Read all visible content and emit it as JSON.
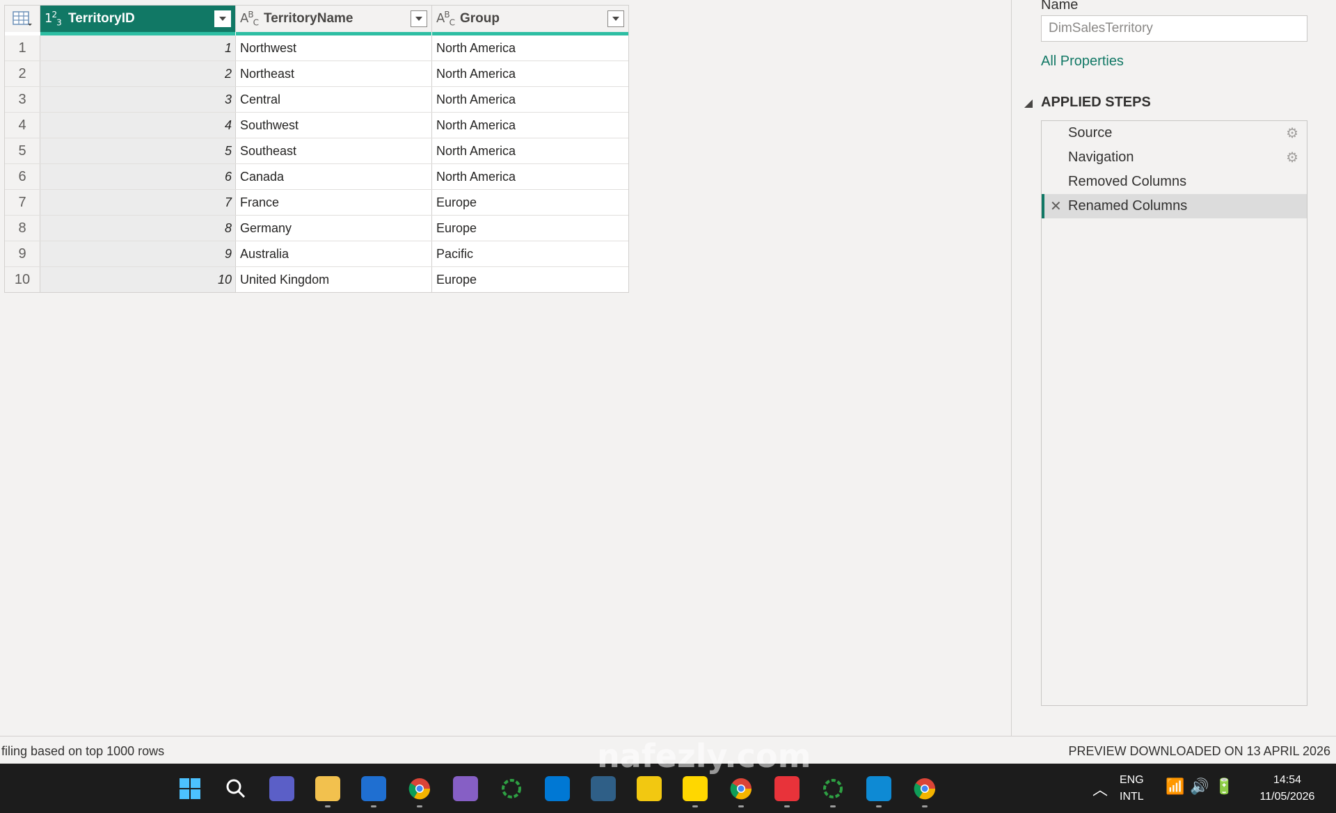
{
  "grid": {
    "columns": [
      {
        "type_icon": "123",
        "label": "TerritoryID"
      },
      {
        "type_icon": "ABC",
        "label": "TerritoryName"
      },
      {
        "type_icon": "ABC",
        "label": "Group"
      }
    ],
    "rows": [
      {
        "n": "1",
        "id": "1",
        "name": "Northwest",
        "group": "North America"
      },
      {
        "n": "2",
        "id": "2",
        "name": "Northeast",
        "group": "North America"
      },
      {
        "n": "3",
        "id": "3",
        "name": "Central",
        "group": "North America"
      },
      {
        "n": "4",
        "id": "4",
        "name": "Southwest",
        "group": "North America"
      },
      {
        "n": "5",
        "id": "5",
        "name": "Southeast",
        "group": "North America"
      },
      {
        "n": "6",
        "id": "6",
        "name": "Canada",
        "group": "North America"
      },
      {
        "n": "7",
        "id": "7",
        "name": "France",
        "group": "Europe"
      },
      {
        "n": "8",
        "id": "8",
        "name": "Germany",
        "group": "Europe"
      },
      {
        "n": "9",
        "id": "9",
        "name": "Australia",
        "group": "Pacific"
      },
      {
        "n": "10",
        "id": "10",
        "name": "United Kingdom",
        "group": "Europe"
      }
    ]
  },
  "properties": {
    "name_label": "Name",
    "name_value": "DimSalesTerritory",
    "all_properties_link": "All Properties"
  },
  "applied_steps": {
    "title": "APPLIED STEPS",
    "steps": [
      {
        "label": "Source",
        "has_gear": true
      },
      {
        "label": "Navigation",
        "has_gear": true
      },
      {
        "label": "Removed Columns",
        "has_gear": false
      },
      {
        "label": "Renamed Columns",
        "has_gear": false,
        "selected": true
      }
    ]
  },
  "status_bar": {
    "left": "filing based on top 1000 rows",
    "right": "PREVIEW DOWNLOADED ON 13 APRIL 2026"
  },
  "taskbar": {
    "apps": [
      {
        "icon": "windows-start-icon",
        "color": "#2b88d8"
      },
      {
        "icon": "search-icon",
        "color": "#1c1c1c"
      },
      {
        "icon": "teams-icon",
        "color": "#5b5fc7"
      },
      {
        "icon": "file-explorer-icon",
        "color": "#f2c14e"
      },
      {
        "icon": "app-store-icon",
        "color": "#1f6fd1"
      },
      {
        "icon": "chrome-icon",
        "color": "#db4437"
      },
      {
        "icon": "visual-studio-icon",
        "color": "#865fc5"
      },
      {
        "icon": "loading-ring-icon",
        "color": "#2ea043"
      },
      {
        "icon": "vscode-icon",
        "color": "#0078d4"
      },
      {
        "icon": "mysql-workbench-icon",
        "color": "#2f5f87"
      },
      {
        "icon": "power-bi-icon",
        "color": "#f2c811"
      },
      {
        "icon": "sticky-notes-icon",
        "color": "#ffd700"
      },
      {
        "icon": "chrome-profile-icon",
        "color": "#db4437"
      },
      {
        "icon": "mail-icon",
        "color": "#e8333a"
      },
      {
        "icon": "loading-ring-icon-2",
        "color": "#2ea043"
      },
      {
        "icon": "photos-icon",
        "color": "#0e8ad4"
      },
      {
        "icon": "chrome-profile-icon-2",
        "color": "#db4437"
      }
    ],
    "language": "ENG",
    "layout": "INTL",
    "time": "14:54",
    "date": "11/05/2026"
  },
  "watermark": "nafezly.com"
}
